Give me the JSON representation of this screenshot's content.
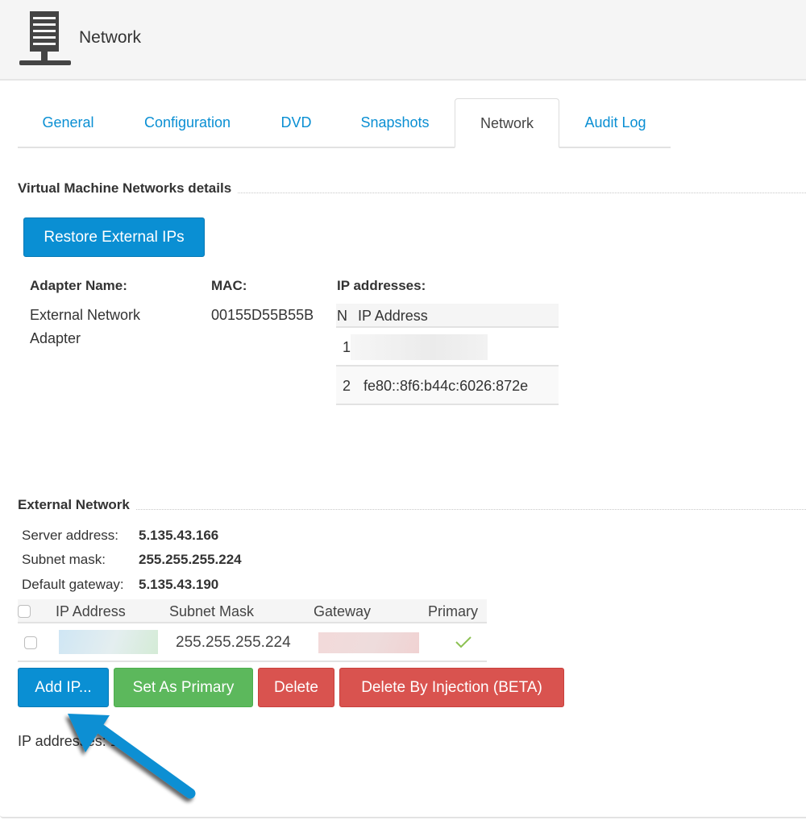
{
  "header": {
    "title": "Network",
    "icon": "server-icon"
  },
  "tabs": [
    {
      "label": "General",
      "active": false
    },
    {
      "label": "Configuration",
      "active": false
    },
    {
      "label": "DVD",
      "active": false
    },
    {
      "label": "Snapshots",
      "active": false
    },
    {
      "label": "Network",
      "active": true
    },
    {
      "label": "Audit Log",
      "active": false
    }
  ],
  "vm_networks": {
    "section_title": "Virtual Machine Networks details",
    "restore_button": "Restore External IPs",
    "columns": {
      "adapter_name": "Adapter Name:",
      "mac": "MAC:",
      "ip_addresses": "IP addresses:"
    },
    "adapter": {
      "name_line1": "External Network",
      "name_line2": "Adapter",
      "mac": "00155D55B55B"
    },
    "ip_table": {
      "headers": {
        "n": "N",
        "ip": "IP Address"
      },
      "rows": [
        {
          "n": "1",
          "ip": "[redacted]"
        },
        {
          "n": "2",
          "ip": "fe80::8f6:b44c:6026:872e"
        }
      ]
    }
  },
  "external_network": {
    "section_title": "External Network",
    "server_address_label": "Server address:",
    "server_address": "5.135.43.166",
    "subnet_mask_label": "Subnet mask:",
    "subnet_mask": "255.255.255.224",
    "default_gateway_label": "Default gateway:",
    "default_gateway": "5.135.43.190",
    "table": {
      "headers": {
        "ip": "IP Address",
        "subnet": "Subnet Mask",
        "gateway": "Gateway",
        "primary": "Primary"
      },
      "rows": [
        {
          "ip": "[redacted]",
          "subnet": "255.255.255.224",
          "gateway": "[redacted]",
          "primary": true
        }
      ]
    },
    "buttons": {
      "add_ip": "Add IP...",
      "set_primary": "Set As Primary",
      "delete": "Delete",
      "delete_injection": "Delete By Injection (BETA)"
    },
    "footer": "IP addresses: 1"
  },
  "colors": {
    "accent": "#0a8fd3",
    "success": "#5cb85c",
    "danger": "#d9534f",
    "annotation_arrow": "#0a8fd3"
  }
}
